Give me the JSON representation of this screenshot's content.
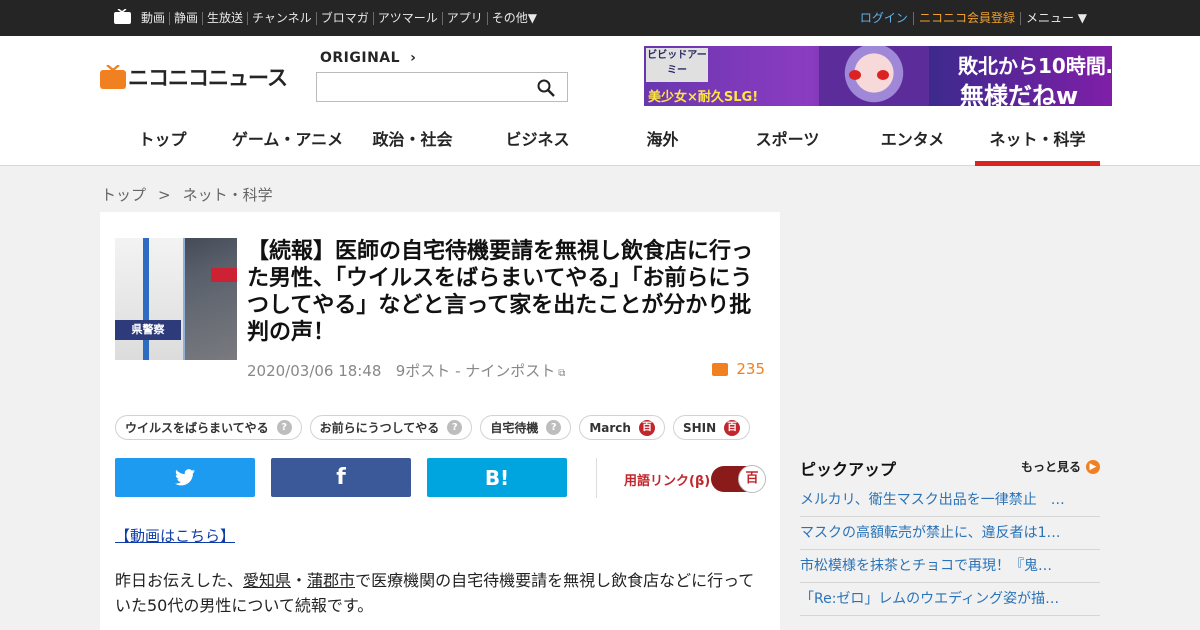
{
  "topbar": {
    "nav": [
      "動画",
      "静画",
      "生放送",
      "チャンネル",
      "ブロマガ",
      "アツマール",
      "アプリ",
      "その他▼"
    ],
    "login": "ログイン",
    "register": "ニコニコ会員登録",
    "menu": "メニュー ▼"
  },
  "header": {
    "logo_text": "ニコニコニュース",
    "original_label": "ORIGINAL",
    "original_chevron": "›",
    "search_value": "",
    "banner": {
      "brand": "ビビッドアーミー",
      "subcopy": "美少女×耐久SLG!",
      "copy1": "敗北から10時間…",
      "copy2": "無様だねw"
    },
    "categories": [
      "トップ",
      "ゲーム・アニメ",
      "政治・社会",
      "ビジネス",
      "海外",
      "スポーツ",
      "エンタメ",
      "ネット・科学"
    ],
    "active_category": "ネット・科学"
  },
  "breadcrumb": {
    "home": "トップ",
    "separator": ">",
    "current": "ネット・科学"
  },
  "article": {
    "thumbnail_label": "県警察",
    "title": "【続報】医師の自宅待機要請を無視し飲食店に行った男性、「ウイルスをばらまいてやる」「お前らにうつしてやる」などと言って家を出たことが分かり批判の声！",
    "date": "2020/03/06 18:48",
    "source": "9ポスト - ナインポスト",
    "comment_count": "235",
    "tags": [
      {
        "label": "ウイルスをばらまいてやる",
        "badge": "?"
      },
      {
        "label": "お前らにうつしてやる",
        "badge": "?"
      },
      {
        "label": "自宅待機",
        "badge": "?"
      },
      {
        "label": "March",
        "badge": "百"
      },
      {
        "label": "SHIN",
        "badge": "百"
      }
    ],
    "share": {
      "twitter": "twitter-icon",
      "facebook": "f",
      "hatena": "B!"
    },
    "yougo_link": "用語リンク(β)",
    "toggle_badge": "百",
    "video_link": "【動画はこちら】",
    "body_prefix": "昨日お伝えした、",
    "body_link1": "愛知県",
    "body_dot": "・",
    "body_link2": "蒲郡市",
    "body_rest": "で医療機関の自宅待機要請を無視し飲食店などに行っていた50代の男性について続報です。"
  },
  "sidebar": {
    "pickup_title": "ピックアップ",
    "more_label": "もっと見る",
    "items": [
      "メルカリ、衛生マスク出品を一律禁止　…",
      "マスクの高額転売が禁止に、違反者は1…",
      "市松模様を抹茶とチョコで再現！『鬼…",
      "「Re:ゼロ」レムのウエディング姿が描…"
    ]
  },
  "colors": {
    "accent_red": "#d22222",
    "orange": "#f08020",
    "link_blue": "#2a73b8",
    "twitter": "#1d9bf0",
    "facebook": "#3b5998",
    "hatena": "#00a4de"
  }
}
